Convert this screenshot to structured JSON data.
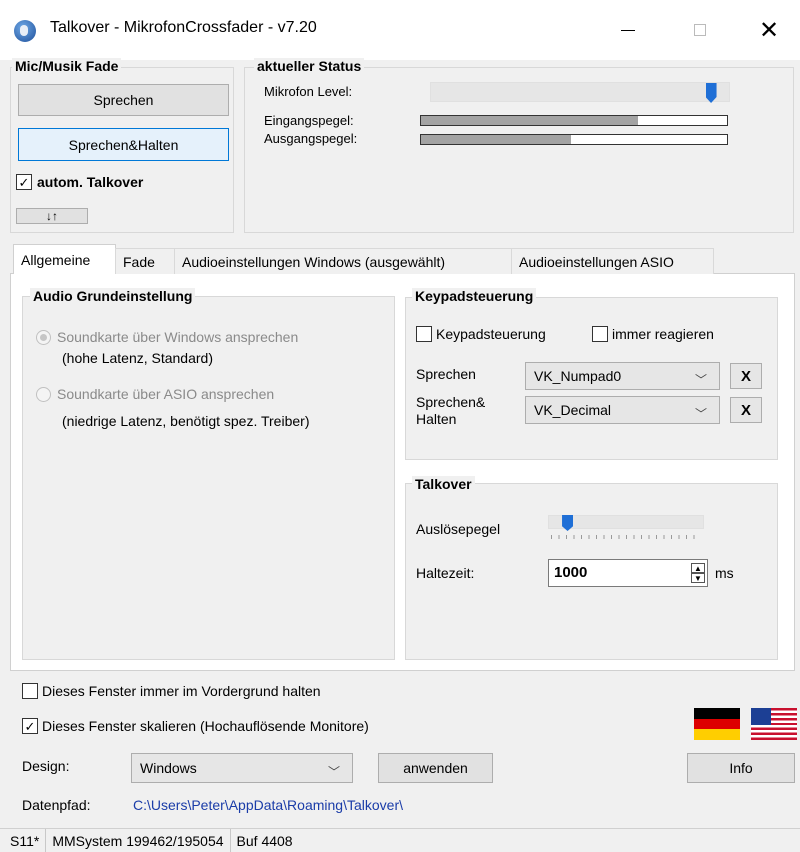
{
  "window": {
    "title": "Talkover - MikrofonCrossfader  - v7.20",
    "minimize_label": "—",
    "maximize_label": "☐",
    "close_label": "✕"
  },
  "mic_music": {
    "title": "Mic/Musik Fade",
    "talk_button": "Sprechen",
    "talk_hold_button": "Sprechen&Halten",
    "auto_talkover_label": "autom. Talkover",
    "auto_talkover_checked": true,
    "swap_button": "↓↑"
  },
  "status": {
    "title": "aktueller Status",
    "mic_level_label": "Mikrofon Level:",
    "mic_level_value": 0.95,
    "input_level_label": "Eingangspegel:",
    "input_level_value": 0.71,
    "output_level_label": "Ausgangspegel:",
    "output_level_value": 0.49
  },
  "tabs": [
    {
      "label": "Allgemeine",
      "active": true
    },
    {
      "label": "Fade",
      "active": false
    },
    {
      "label": "Audioeinstellungen Windows (ausgewählt)",
      "active": false
    },
    {
      "label": "Audioeinstellungen ASIO",
      "active": false
    }
  ],
  "audio_basic": {
    "title": "Audio Grundeinstellung",
    "windows_option": "Soundkarte über Windows ansprechen",
    "windows_desc": "(hohe Latenz, Standard)",
    "asio_option": "Soundkarte über ASIO ansprechen",
    "asio_desc": "(niedrige Latenz, benötigt spez. Treiber)",
    "selected": "windows"
  },
  "keypad": {
    "title": "Keypadsteuerung",
    "keypad_checkbox": "Keypadsteuerung",
    "keypad_checked": false,
    "always_react_checkbox": "immer reagieren",
    "always_react_checked": false,
    "talk_label": "Sprechen",
    "talk_value": "VK_Numpad0",
    "talk_hold_label_1": "Sprechen&",
    "talk_hold_label_2": "Halten",
    "talk_hold_value": "VK_Decimal",
    "clear_label": "X"
  },
  "talkover": {
    "title": "Talkover",
    "trigger_label": "Auslösepegel",
    "trigger_value": 0.09,
    "hold_label": "Haltezeit:",
    "hold_value": "1000",
    "hold_unit": "ms"
  },
  "options": {
    "foreground_label": "Dieses Fenster immer im Vordergrund halten",
    "foreground_checked": false,
    "scale_label": "Dieses Fenster skalieren (Hochauflösende Monitore)",
    "scale_checked": true,
    "design_label": "Design:",
    "design_value": "Windows",
    "apply_button": "anwenden",
    "info_button": "Info",
    "data_path_label": "Datenpfad:",
    "data_path_value": "C:\\Users\\Peter\\AppData\\Roaming\\Talkover\\"
  },
  "statusbar": {
    "cell1": "S11*",
    "cell2": "MMSystem 199462/195054",
    "cell3": "Buf 4408"
  },
  "icons": {
    "app": "microphone-app-icon",
    "german_flag": "german-flag-icon",
    "us_flag": "us-flag-icon"
  },
  "colors": {
    "accent": "#0078d7",
    "link": "#1a3ca8",
    "slider_thumb": "#1f6fd6"
  }
}
